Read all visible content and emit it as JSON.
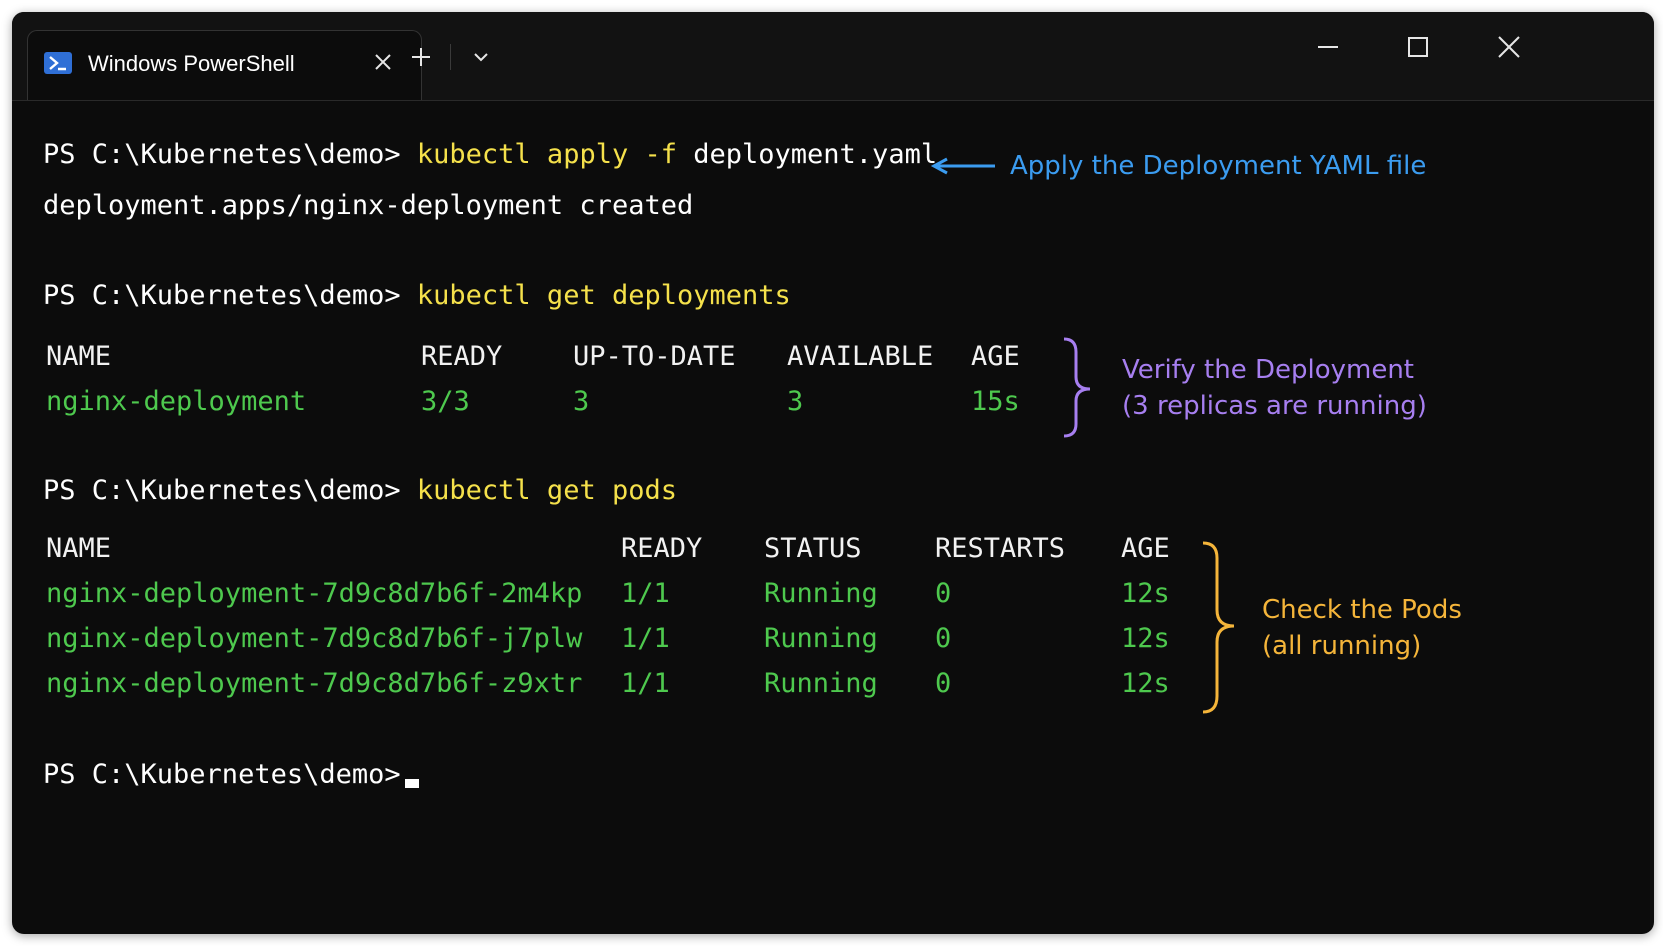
{
  "window": {
    "tab_title": "Windows PowerShell",
    "new_tab_symbol": "+",
    "icons": [
      "powershell-icon",
      "close-icon",
      "plus-icon",
      "chevron-down-icon",
      "minimize-icon",
      "maximize-icon",
      "close-window-icon"
    ]
  },
  "prompt": "PS C:\\Kubernetes\\demo>",
  "commands": {
    "apply": {
      "cmd": "kubectl apply -f",
      "arg": "deployment.yaml",
      "output": "deployment.apps/nginx-deployment created"
    },
    "get_deployments": {
      "cmd": "kubectl get deployments"
    },
    "get_pods": {
      "cmd": "kubectl get pods"
    }
  },
  "deployments_table": {
    "headers": [
      "NAME",
      "READY",
      "UP-TO-DATE",
      "AVAILABLE",
      "AGE"
    ],
    "rows": [
      [
        "nginx-deployment",
        "3/3",
        "3",
        "3",
        "15s"
      ]
    ]
  },
  "pods_table": {
    "headers": [
      "NAME",
      "READY",
      "STATUS",
      "RESTARTS",
      "AGE"
    ],
    "rows": [
      [
        "nginx-deployment-7d9c8d7b6f-2m4kp",
        "1/1",
        "Running",
        "0",
        "12s"
      ],
      [
        "nginx-deployment-7d9c8d7b6f-j7plw",
        "1/1",
        "Running",
        "0",
        "12s"
      ],
      [
        "nginx-deployment-7d9c8d7b6f-z9xtr",
        "1/1",
        "Running",
        "0",
        "12s"
      ]
    ]
  },
  "annotations": {
    "apply": "Apply the Deployment YAML file",
    "verify": [
      "Verify the Deployment",
      "(3 replicas are running)"
    ],
    "pods": [
      "Check the Pods",
      "(all running)"
    ]
  },
  "colors": {
    "background": "#0c0c0c",
    "command": "#f5e14b",
    "output_green": "#4ec94e",
    "annotation_blue": "#3b9cf0",
    "annotation_purple": "#a77ff0",
    "annotation_orange": "#f5b53a"
  }
}
